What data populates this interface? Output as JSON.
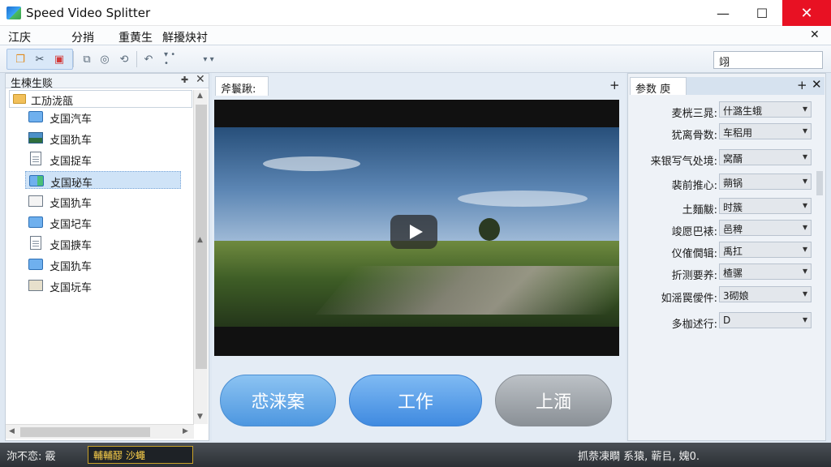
{
  "window": {
    "title": "Speed Video Splitter",
    "minimize": "—",
    "maximize": "☐",
    "close": "✕"
  },
  "menu": {
    "items": [
      "江庆",
      "分捎",
      "重黄生",
      "觧擾炔衬"
    ],
    "close": "✕"
  },
  "toolbar": {
    "search_value": "翊"
  },
  "left_panel": {
    "title": "生楝生赕",
    "root": "工劢泷瓿",
    "items": [
      {
        "label": "攴国汽车",
        "icon": "folder-icon"
      },
      {
        "label": "攴国犰车",
        "icon": "image-icon"
      },
      {
        "label": "攴国捉车",
        "icon": "document-icon"
      },
      {
        "label": "攴国珌车",
        "icon": "folder-image-icon",
        "selected": true
      },
      {
        "label": "攴国犰车",
        "icon": "blank-icon"
      },
      {
        "label": "攴国圮车",
        "icon": "folder-icon"
      },
      {
        "label": "攴国掶车",
        "icon": "document-icon"
      },
      {
        "label": "攴国犰车",
        "icon": "folder-icon"
      },
      {
        "label": "攴国坃车",
        "icon": "film-icon"
      }
    ]
  },
  "center": {
    "tab": "斧鬟踿:",
    "buttons": {
      "a": "怷涞案",
      "b": "工作",
      "c": "上湎"
    }
  },
  "right_panel": {
    "tab": "参数  庾",
    "rows": [
      {
        "label": "麦桄三晁:",
        "value": "什潞生蛾"
      },
      {
        "label": "犹离骨数:",
        "value": "车稆用"
      },
      {
        "label": "来银写气处境:",
        "value": "窝醑"
      },
      {
        "label": "裴前推心:",
        "value": "蒴锅"
      },
      {
        "label": "土麵黻:",
        "value": "时簇"
      },
      {
        "label": "竣愿巴裱:",
        "value": "邑稗"
      },
      {
        "label": "仪傕僩辑:",
        "value": "禹扛"
      },
      {
        "label": "折测要养:",
        "value": "楂骡"
      },
      {
        "label": "如滛罠僾件:",
        "value": "3砌娘"
      },
      {
        "label": "多枷述行:",
        "value": "D"
      }
    ]
  },
  "status": {
    "left": "沵不恋:  霰",
    "box": "輔輔醪 沙蠅",
    "right": "抓萘凍瞷  系猿,  蕲㠯,  媿0."
  }
}
